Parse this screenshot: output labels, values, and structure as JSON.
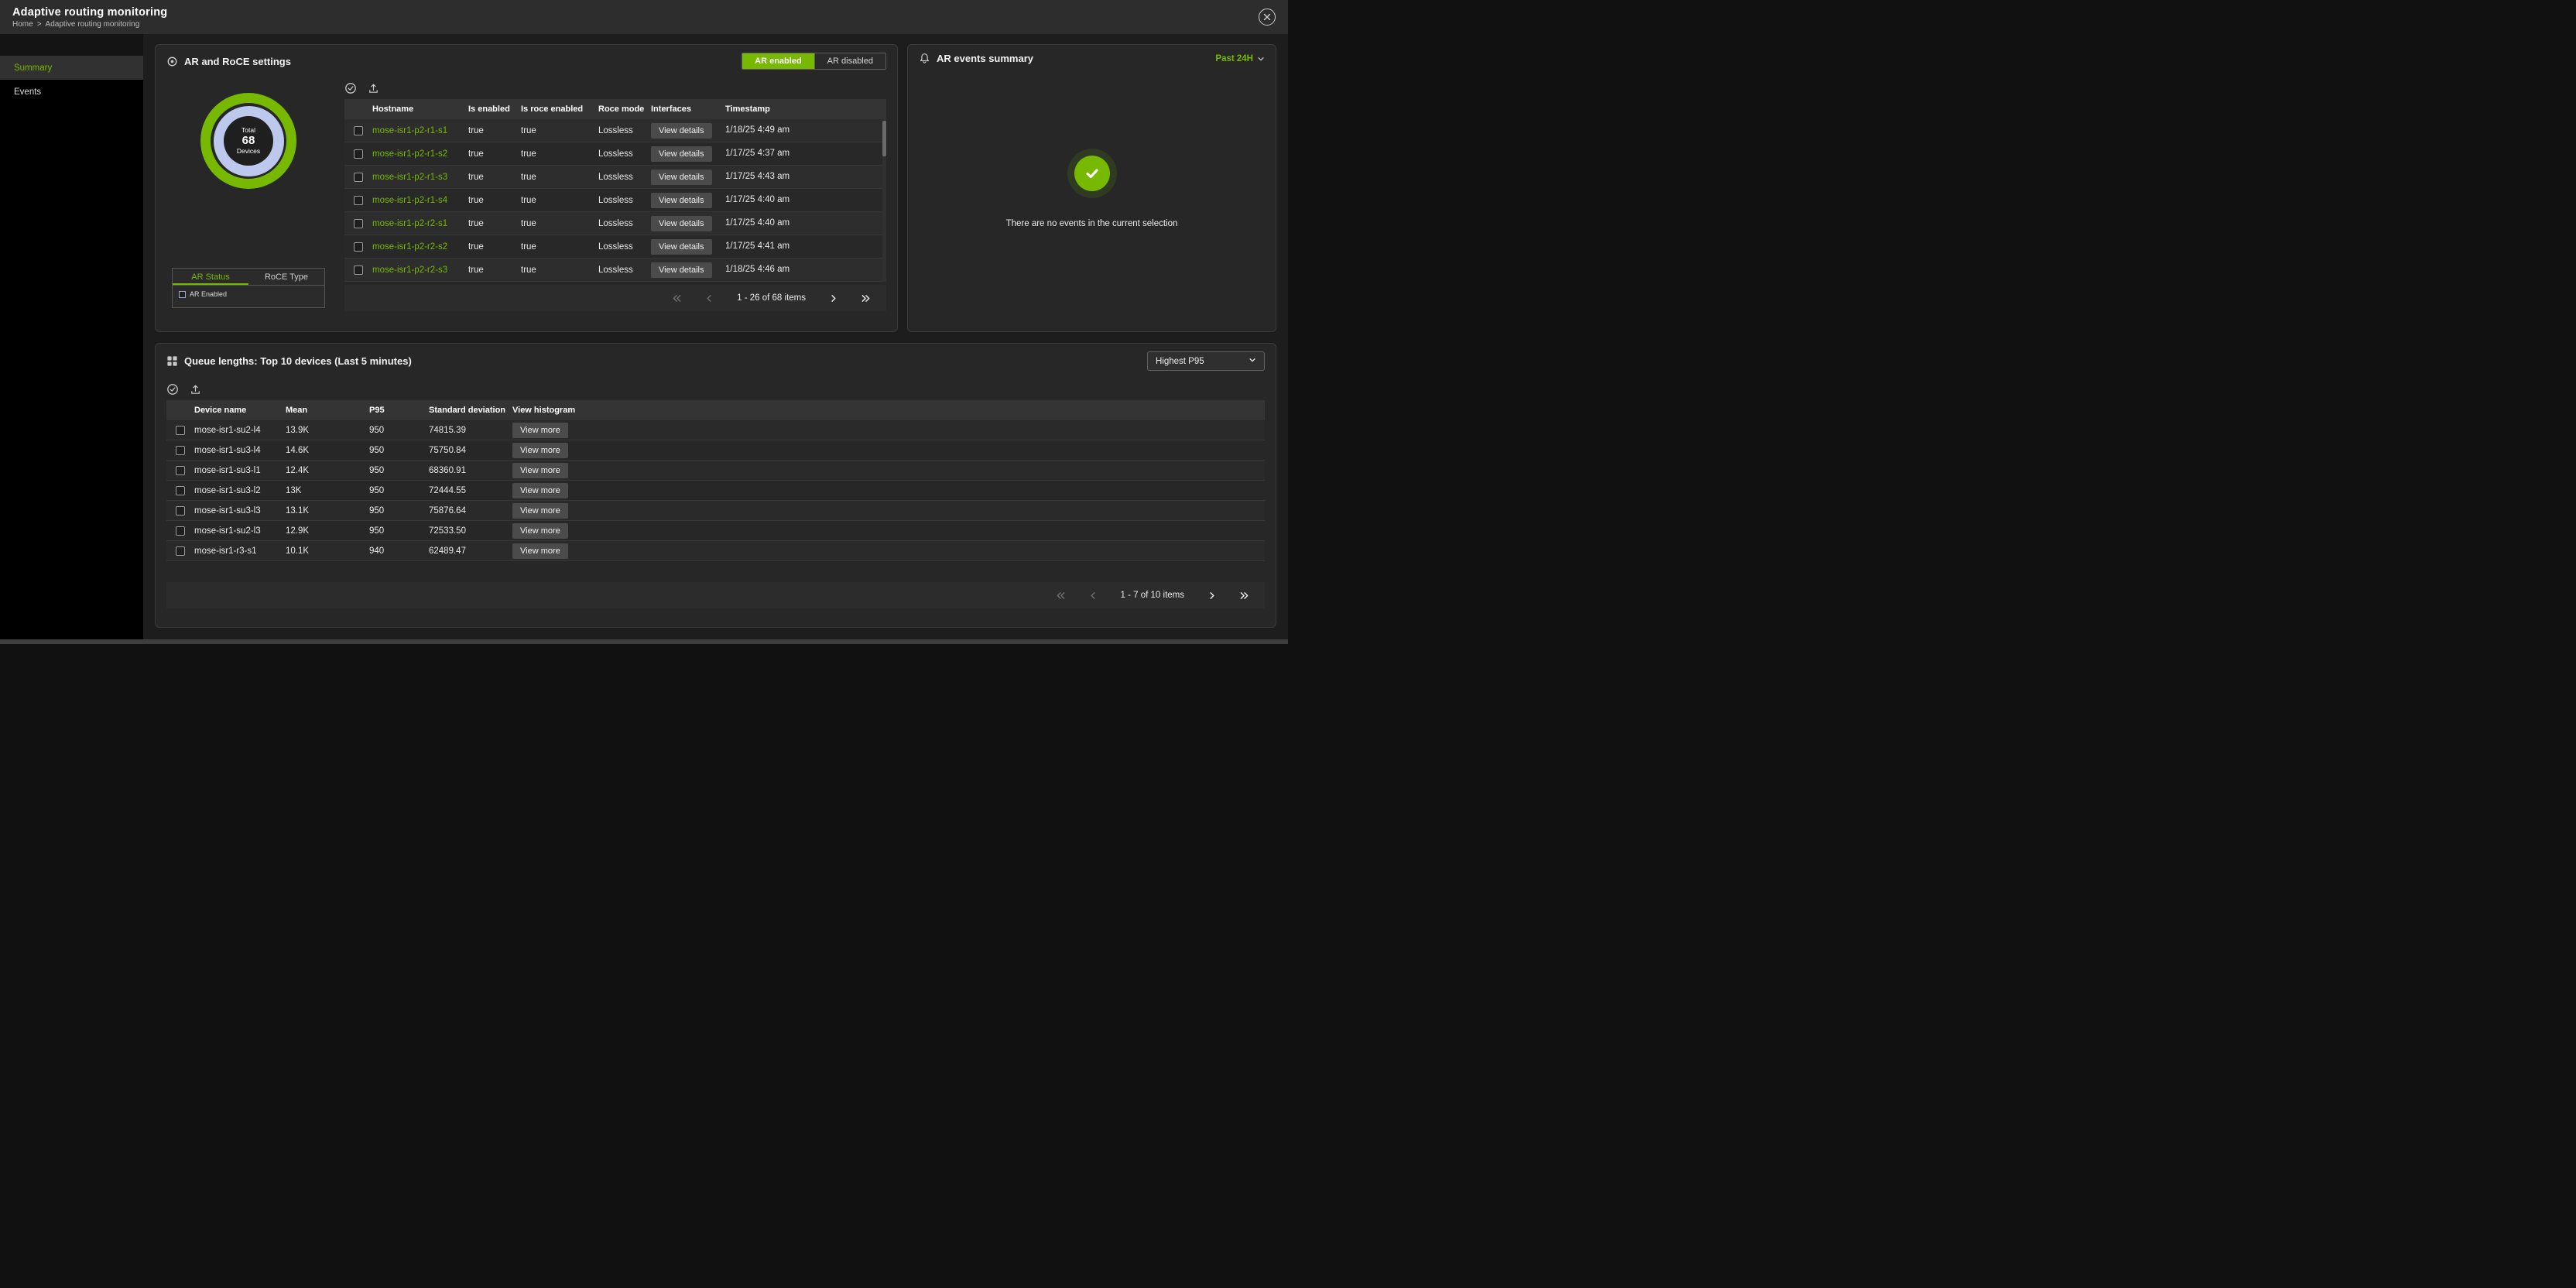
{
  "header": {
    "title": "Adaptive routing monitoring",
    "breadcrumb": {
      "home": "Home",
      "separator": ">",
      "current": "Adaptive routing monitoring"
    }
  },
  "sidebar": {
    "items": [
      {
        "label": "Summary",
        "active": true
      },
      {
        "label": "Events",
        "active": false
      }
    ]
  },
  "ar_panel": {
    "title": "AR and RoCE settings",
    "toggle": {
      "options": [
        {
          "label": "AR enabled",
          "active": true
        },
        {
          "label": "AR disabled",
          "active": false
        }
      ]
    },
    "donut_center": {
      "top": "Total",
      "value": "68",
      "bottom": "Devices"
    },
    "tabs": [
      {
        "label": "AR Status",
        "active": true
      },
      {
        "label": "RoCE Type",
        "active": false
      }
    ],
    "legend": [
      {
        "label": "AR Enabled"
      }
    ],
    "table": {
      "columns": [
        "Hostname",
        "Is enabled",
        "Is roce enabled",
        "Roce mode",
        "Interfaces",
        "Timestamp"
      ],
      "action_label": "View details",
      "rows": [
        {
          "hostname": "mose-isr1-p2-r1-s1",
          "is_enabled": "true",
          "is_roce_enabled": "true",
          "roce_mode": "Lossless",
          "timestamp": "1/18/25 4:49 am"
        },
        {
          "hostname": "mose-isr1-p2-r1-s2",
          "is_enabled": "true",
          "is_roce_enabled": "true",
          "roce_mode": "Lossless",
          "timestamp": "1/17/25 4:37 am"
        },
        {
          "hostname": "mose-isr1-p2-r1-s3",
          "is_enabled": "true",
          "is_roce_enabled": "true",
          "roce_mode": "Lossless",
          "timestamp": "1/17/25 4:43 am"
        },
        {
          "hostname": "mose-isr1-p2-r1-s4",
          "is_enabled": "true",
          "is_roce_enabled": "true",
          "roce_mode": "Lossless",
          "timestamp": "1/17/25 4:40 am"
        },
        {
          "hostname": "mose-isr1-p2-r2-s1",
          "is_enabled": "true",
          "is_roce_enabled": "true",
          "roce_mode": "Lossless",
          "timestamp": "1/17/25 4:40 am"
        },
        {
          "hostname": "mose-isr1-p2-r2-s2",
          "is_enabled": "true",
          "is_roce_enabled": "true",
          "roce_mode": "Lossless",
          "timestamp": "1/17/25 4:41 am"
        },
        {
          "hostname": "mose-isr1-p2-r2-s3",
          "is_enabled": "true",
          "is_roce_enabled": "true",
          "roce_mode": "Lossless",
          "timestamp": "1/18/25 4:46 am"
        }
      ]
    },
    "pagination": {
      "label": "1 - 26 of 68 items"
    }
  },
  "events_panel": {
    "title": "AR events summary",
    "time_range": "Past 24H",
    "empty_message": "There are no events in the current selection"
  },
  "queue_panel": {
    "title": "Queue lengths: Top 10 devices (Last 5 minutes)",
    "sort_selected": "Highest P95",
    "table": {
      "columns": [
        "Device name",
        "Mean",
        "P95",
        "Standard deviation",
        "View histogram"
      ],
      "action_label": "View more",
      "rows": [
        {
          "device_name": "mose-isr1-su2-l4",
          "mean": "13.9K",
          "p95": "950",
          "std_deviation": "74815.39"
        },
        {
          "device_name": "mose-isr1-su3-l4",
          "mean": "14.6K",
          "p95": "950",
          "std_deviation": "75750.84"
        },
        {
          "device_name": "mose-isr1-su3-l1",
          "mean": "12.4K",
          "p95": "950",
          "std_deviation": "68360.91"
        },
        {
          "device_name": "mose-isr1-su3-l2",
          "mean": "13K",
          "p95": "950",
          "std_deviation": "72444.55"
        },
        {
          "device_name": "mose-isr1-su3-l3",
          "mean": "13.1K",
          "p95": "950",
          "std_deviation": "75876.64"
        },
        {
          "device_name": "mose-isr1-su2-l3",
          "mean": "12.9K",
          "p95": "950",
          "std_deviation": "72533.50"
        },
        {
          "device_name": "mose-isr1-r3-s1",
          "mean": "10.1K",
          "p95": "940",
          "std_deviation": "62489.47"
        }
      ]
    },
    "pagination": {
      "label": "1 - 7 of 10 items"
    }
  },
  "colors": {
    "accent": "#76b900",
    "donut_outer_ring": "#76b900",
    "donut_inner_ring": "#bcc8ec",
    "panel_background": "#272727",
    "sidebar_background": "#000000"
  },
  "chart_data": {
    "type": "pie",
    "title": "AR Status",
    "categories": [
      "AR Enabled"
    ],
    "values": [
      68
    ],
    "center_label": {
      "top": "Total",
      "value": "68",
      "bottom": "Devices"
    },
    "rings": [
      {
        "name": "ar-status-ring",
        "color": "#76b900",
        "value": 68
      },
      {
        "name": "roce-type-ring",
        "color": "#bcc8ec",
        "value": 68
      }
    ],
    "legend_position": "bottom-left"
  }
}
